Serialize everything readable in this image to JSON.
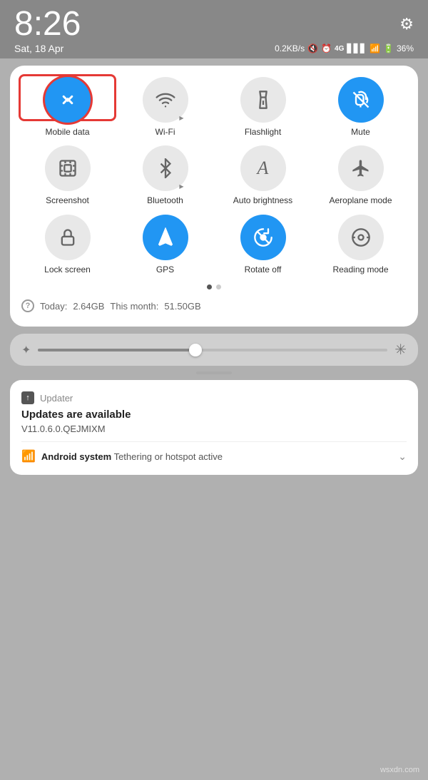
{
  "statusBar": {
    "time": "8:26",
    "date": "Sat, 18 Apr",
    "speed": "0.2KB/s",
    "battery": "36%"
  },
  "tiles": [
    {
      "id": "mobile-data",
      "label": "Mobile data",
      "active": true,
      "highlighted": true,
      "icon": "arrows-updown"
    },
    {
      "id": "wifi",
      "label": "Wi-Fi",
      "active": false,
      "highlighted": false,
      "icon": "wifi",
      "hasArrow": true
    },
    {
      "id": "flashlight",
      "label": "Flashlight",
      "active": false,
      "highlighted": false,
      "icon": "flashlight"
    },
    {
      "id": "mute",
      "label": "Mute",
      "active": true,
      "highlighted": false,
      "icon": "bell-slash"
    },
    {
      "id": "screenshot",
      "label": "Screenshot",
      "active": false,
      "highlighted": false,
      "icon": "screenshot"
    },
    {
      "id": "bluetooth",
      "label": "Bluetooth",
      "active": false,
      "highlighted": false,
      "icon": "bluetooth",
      "hasArrow": true
    },
    {
      "id": "auto-brightness",
      "label": "Auto brightness",
      "active": false,
      "highlighted": false,
      "icon": "letter-a"
    },
    {
      "id": "aeroplane",
      "label": "Aeroplane mode",
      "active": false,
      "highlighted": false,
      "icon": "plane"
    },
    {
      "id": "lock-screen",
      "label": "Lock screen",
      "active": false,
      "highlighted": false,
      "icon": "lock"
    },
    {
      "id": "gps",
      "label": "GPS",
      "active": true,
      "highlighted": false,
      "icon": "location"
    },
    {
      "id": "rotate-off",
      "label": "Rotate off",
      "active": true,
      "highlighted": false,
      "icon": "rotate"
    },
    {
      "id": "reading-mode",
      "label": "Reading mode",
      "active": false,
      "highlighted": false,
      "icon": "eye"
    }
  ],
  "pagination": {
    "current": 0,
    "total": 2
  },
  "dataUsage": {
    "today_label": "Today:",
    "today_value": "2.64GB",
    "month_label": "This month:",
    "month_value": "51.50GB"
  },
  "brightness": {
    "level": 45
  },
  "notification": {
    "app": "Updater",
    "app_icon": "↑",
    "title": "Updates are available",
    "body": "V11.0.6.0.QEJMIXM",
    "secondary_app": "Android system",
    "secondary_text": "Tethering or hotspot active"
  },
  "watermark": "wsxdn.com"
}
